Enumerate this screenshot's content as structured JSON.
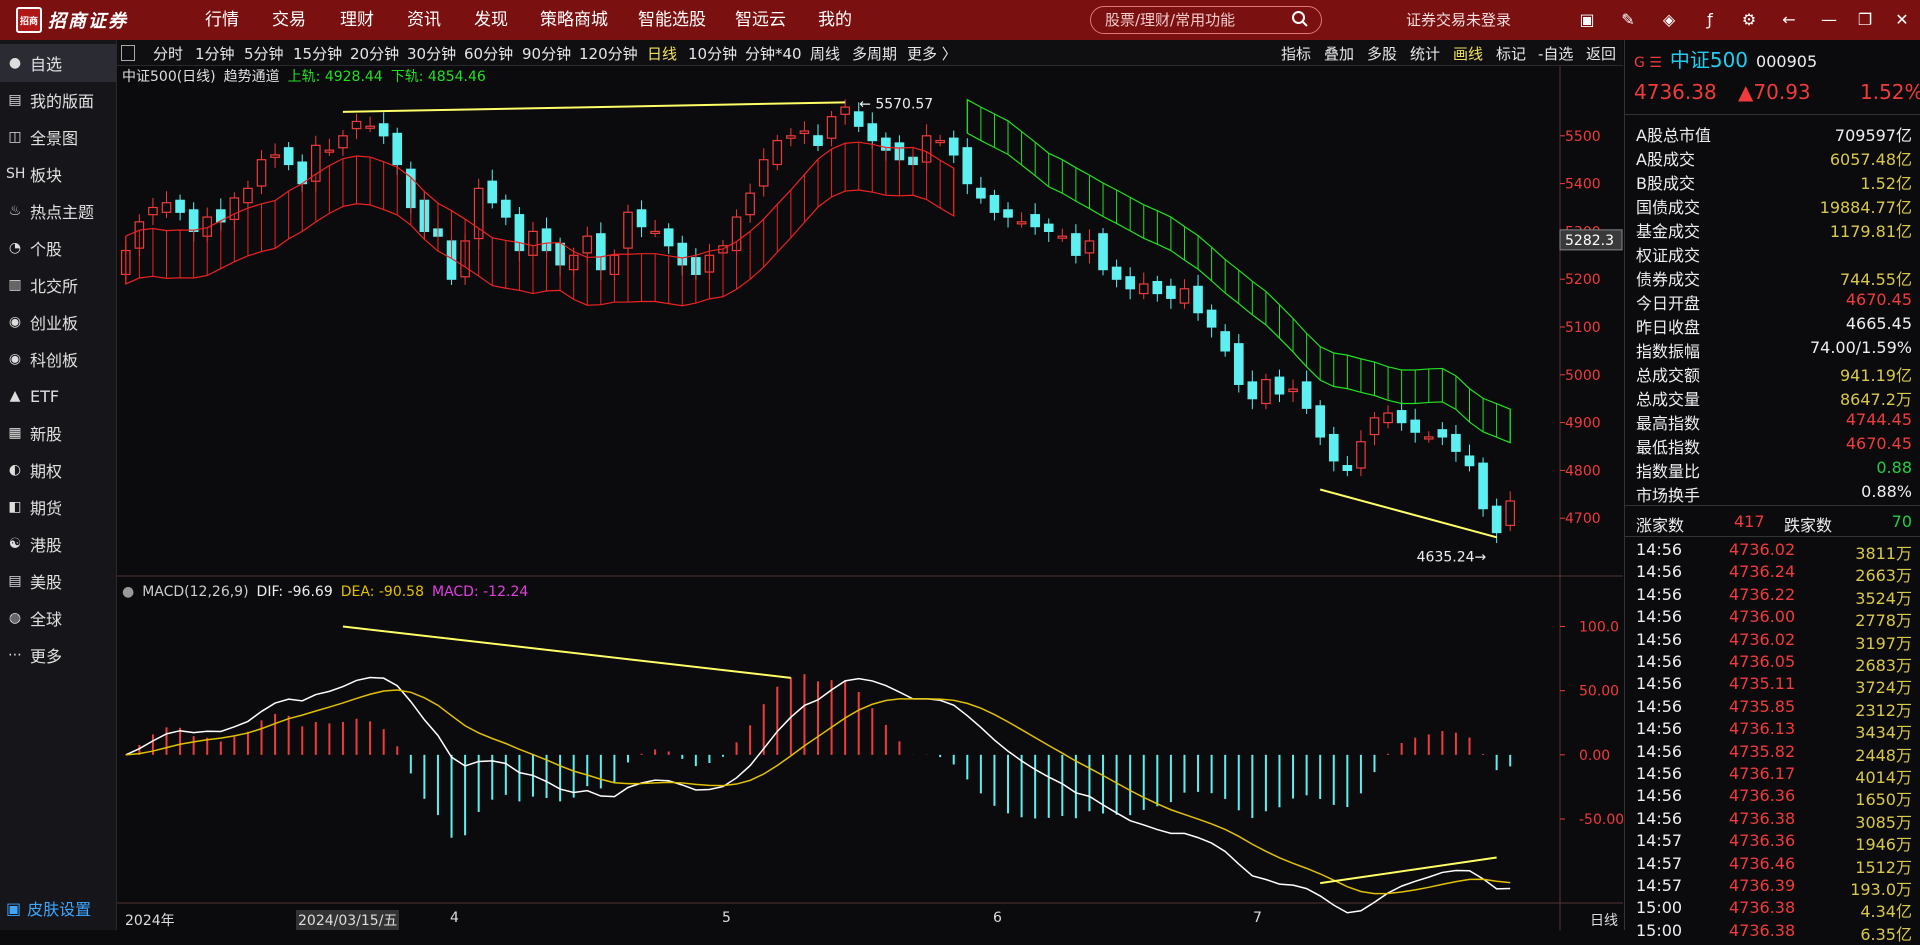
{
  "app": {
    "brand": "招商证券",
    "menus": [
      "行情",
      "交易",
      "理财",
      "资讯",
      "发现",
      "策略商城",
      "智能选股",
      "智远云",
      "我的"
    ],
    "search_placeholder": "股票/理财/常用功能",
    "login_status": "证券交易未登录"
  },
  "sidebar": {
    "items": [
      "自选",
      "我的版面",
      "全景图",
      "板块",
      "热点主题",
      "个股",
      "北交所",
      "创业板",
      "科创板",
      "ETF",
      "新股",
      "期权",
      "期货",
      "港股",
      "美股",
      "全球",
      "更多"
    ],
    "skin": "皮肤设置"
  },
  "periods": [
    "分时",
    "1分钟",
    "5分钟",
    "15分钟",
    "20分钟",
    "30分钟",
    "60分钟",
    "90分钟",
    "120分钟",
    "日线",
    "10分钟",
    "分钟*40",
    "周线",
    "多周期",
    "更多 〉"
  ],
  "tools": [
    "指标",
    "叠加",
    "多股",
    "统计",
    "画线",
    "标记",
    "-自选",
    "返回"
  ],
  "chart_header": {
    "name": "中证500(日线)",
    "indicator": "趋势通道",
    "upper": "上轨: 4928.44",
    "lower": "下轨: 4854.46"
  },
  "macd_header": {
    "name": "MACD(12,26,9)",
    "dif": "DIF: -96.69",
    "dea": "DEA: -90.58",
    "macd": "MACD: -12.24"
  },
  "price_axis": [
    "5500",
    "5400",
    "5300",
    "5200",
    "5100",
    "5000",
    "4900",
    "4800",
    "4700"
  ],
  "current_tag": "5282.3",
  "macd_axis": [
    "100.0",
    "50.00",
    "0.00",
    "-50.00"
  ],
  "high_label": "5570.57",
  "low_label": "4635.24",
  "x_labels": [
    "2024年",
    "2024/03/15/五",
    "4",
    "5",
    "6",
    "7",
    "日线"
  ],
  "colors": {
    "up": "#ef3b3b",
    "down": "#5ef0f0",
    "upper_band": "#22e022",
    "lower_band": "#ee2222",
    "dif": "#ffffff",
    "dea": "#e0c000",
    "macd_label": "#e040e0"
  },
  "quote": {
    "name": "中证500",
    "code": "000905",
    "price": "4736.38",
    "change": "▲70.93",
    "pct": "1.52%"
  },
  "stats": [
    {
      "k": "A股总市值",
      "v": "709597亿",
      "c": "#eee"
    },
    {
      "k": "A股成交",
      "v": "6057.48亿",
      "c": "#d8c84a"
    },
    {
      "k": "B股成交",
      "v": "1.52亿",
      "c": "#d8c84a"
    },
    {
      "k": "国债成交",
      "v": "19884.77亿",
      "c": "#d8c84a"
    },
    {
      "k": "基金成交",
      "v": "1179.81亿",
      "c": "#d8c84a"
    },
    {
      "k": "权证成交",
      "v": "",
      "c": "#d8c84a"
    },
    {
      "k": "债券成交",
      "v": "744.55亿",
      "c": "#d8c84a"
    },
    {
      "k": "今日开盘",
      "v": "4670.45",
      "c": "#ef3b3b"
    },
    {
      "k": "昨日收盘",
      "v": "4665.45",
      "c": "#eee"
    },
    {
      "k": "指数振幅",
      "v": "74.00/1.59%",
      "c": "#eee"
    },
    {
      "k": "总成交额",
      "v": "941.19亿",
      "c": "#d8c84a"
    },
    {
      "k": "总成交量",
      "v": "8647.2万",
      "c": "#d8c84a"
    },
    {
      "k": "最高指数",
      "v": "4744.45",
      "c": "#ef3b3b"
    },
    {
      "k": "最低指数",
      "v": "4670.45",
      "c": "#ef3b3b"
    },
    {
      "k": "指数量比",
      "v": "0.88",
      "c": "#22cc44"
    },
    {
      "k": "市场换手",
      "v": "0.88%",
      "c": "#eee"
    }
  ],
  "breadth": {
    "up_label": "涨家数",
    "up": "417",
    "down_label": "跌家数",
    "down": "70"
  },
  "ticks": [
    {
      "t": "14:56",
      "p": "4736.02",
      "v": "3811万"
    },
    {
      "t": "14:56",
      "p": "4736.24",
      "v": "2663万"
    },
    {
      "t": "14:56",
      "p": "4736.22",
      "v": "3524万"
    },
    {
      "t": "14:56",
      "p": "4736.00",
      "v": "2778万"
    },
    {
      "t": "14:56",
      "p": "4736.02",
      "v": "3197万"
    },
    {
      "t": "14:56",
      "p": "4736.05",
      "v": "2683万"
    },
    {
      "t": "14:56",
      "p": "4735.11",
      "v": "3724万"
    },
    {
      "t": "14:56",
      "p": "4735.85",
      "v": "2312万"
    },
    {
      "t": "14:56",
      "p": "4736.13",
      "v": "3434万"
    },
    {
      "t": "14:56",
      "p": "4735.82",
      "v": "2448万"
    },
    {
      "t": "14:56",
      "p": "4736.17",
      "v": "4014万"
    },
    {
      "t": "14:56",
      "p": "4736.36",
      "v": "1650万"
    },
    {
      "t": "14:56",
      "p": "4736.38",
      "v": "3085万"
    },
    {
      "t": "14:57",
      "p": "4736.36",
      "v": "1946万"
    },
    {
      "t": "14:57",
      "p": "4736.46",
      "v": "1512万"
    },
    {
      "t": "14:57",
      "p": "4736.39",
      "v": "193.0万"
    },
    {
      "t": "15:00",
      "p": "4736.38",
      "v": "4.34亿"
    },
    {
      "t": "15:00",
      "p": "4736.38",
      "v": "6.35亿"
    }
  ],
  "chart_data": {
    "type": "candlestick",
    "title": "中证500(日线)",
    "y_range": [
      4600,
      5600
    ],
    "closes": [
      5260,
      5320,
      5350,
      5360,
      5340,
      5300,
      5330,
      5320,
      5370,
      5390,
      5450,
      5460,
      5440,
      5400,
      5480,
      5470,
      5500,
      5530,
      5520,
      5500,
      5440,
      5350,
      5300,
      5290,
      5200,
      5280,
      5390,
      5360,
      5330,
      5260,
      5300,
      5260,
      5230,
      5250,
      5290,
      5220,
      5250,
      5340,
      5310,
      5300,
      5270,
      5230,
      5210,
      5250,
      5270,
      5330,
      5380,
      5450,
      5490,
      5500,
      5510,
      5480,
      5540,
      5560,
      5520,
      5490,
      5470,
      5450,
      5440,
      5500,
      5490,
      5460,
      5400,
      5370,
      5340,
      5330,
      5320,
      5310,
      5300,
      5290,
      5250,
      5280,
      5220,
      5200,
      5180,
      5190,
      5170,
      5160,
      5180,
      5130,
      5100,
      5050,
      4980,
      4950,
      4990,
      4960,
      4970,
      4930,
      4870,
      4820,
      4800,
      4860,
      4910,
      4920,
      4900,
      4880,
      4870,
      4870,
      4840,
      4810,
      4720,
      4670,
      4736
    ],
    "macd_range": [
      -110,
      130
    ]
  }
}
